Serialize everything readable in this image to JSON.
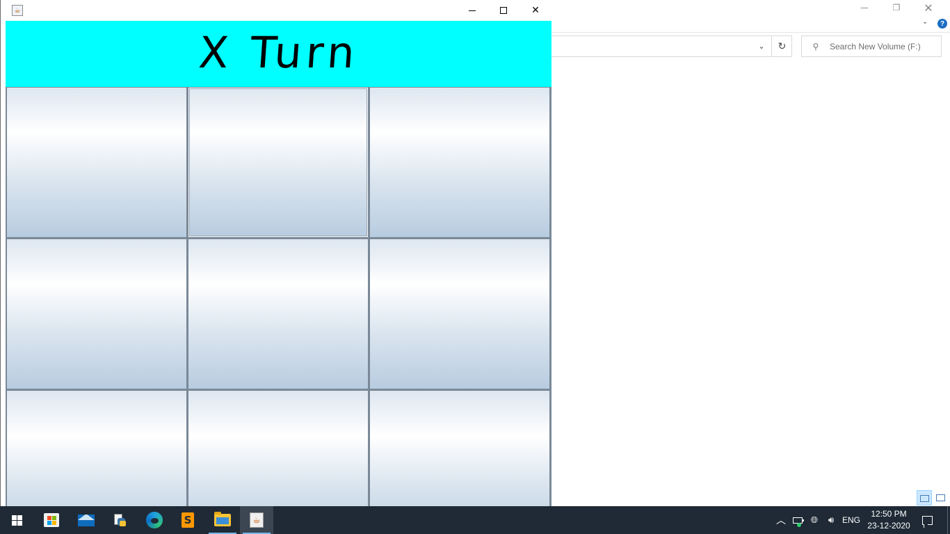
{
  "explorer": {
    "search_placeholder": "Search New Volume (F:)",
    "controls": {
      "minimize_icon": "minimize-icon",
      "restore_icon": "restore-icon",
      "close_icon": "close-icon"
    },
    "view_modes": [
      "details",
      "large-icons"
    ]
  },
  "game_window": {
    "title": "",
    "turn_text": "X Turn",
    "banner_color": "#00ffff",
    "board": {
      "rows": 3,
      "cols": 3,
      "cells": [
        "",
        "",
        "",
        "",
        "",
        "",
        "",
        "",
        ""
      ],
      "focused_cell": 1
    }
  },
  "taskbar": {
    "apps": [
      {
        "name": "start",
        "icon": "windows-icon"
      },
      {
        "name": "microsoft-store",
        "icon": "store-icon"
      },
      {
        "name": "mail",
        "icon": "mail-icon"
      },
      {
        "name": "python",
        "icon": "python-icon"
      },
      {
        "name": "edge",
        "icon": "edge-icon"
      },
      {
        "name": "sublime-text",
        "icon": "sublime-icon"
      },
      {
        "name": "file-explorer",
        "icon": "folder-icon",
        "state": "open"
      },
      {
        "name": "java",
        "icon": "java-icon",
        "state": "active"
      }
    ],
    "tray": {
      "language": "ENG",
      "time": "12:50 PM",
      "date": "23-12-2020"
    },
    "accent_color": "#76b9ed"
  }
}
